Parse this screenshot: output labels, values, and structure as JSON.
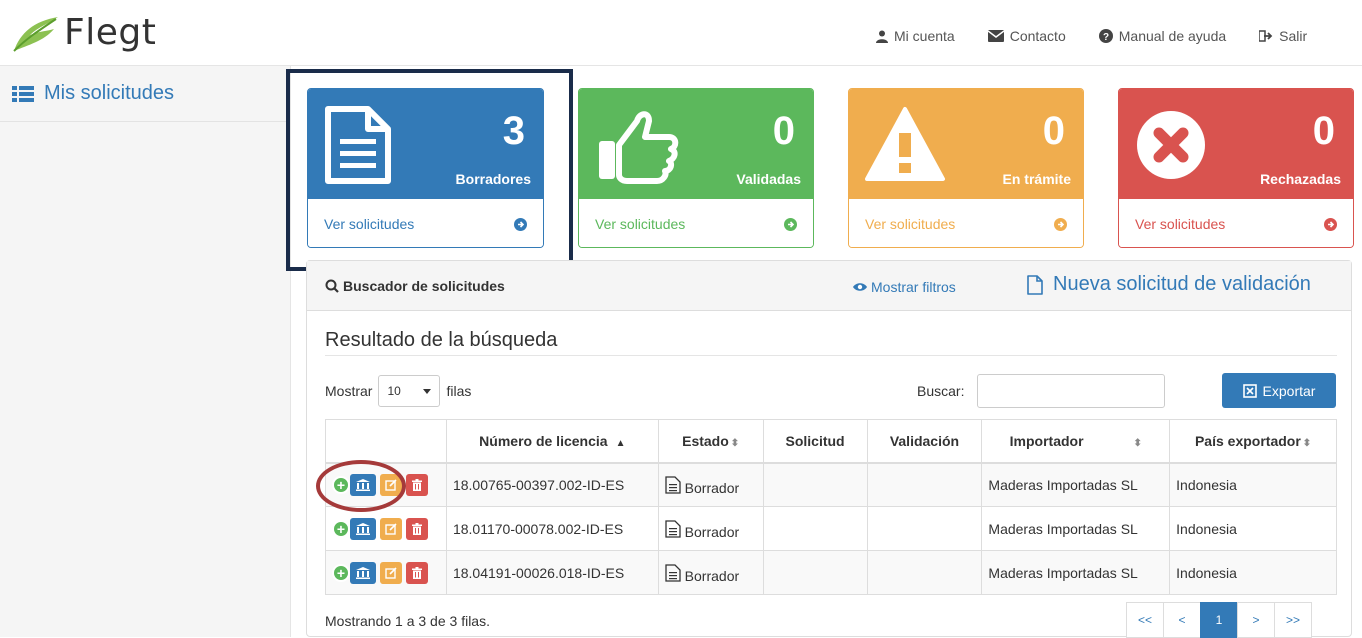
{
  "app": {
    "name": "Flegt"
  },
  "topnav": [
    {
      "label": "Mi cuenta",
      "icon": "user-icon"
    },
    {
      "label": "Contacto",
      "icon": "envelope-icon"
    },
    {
      "label": "Manual de ayuda",
      "icon": "question-circle-icon"
    },
    {
      "label": "Salir",
      "icon": "sign-out-icon"
    }
  ],
  "sidebar": {
    "items": [
      {
        "label": "Mis solicitudes",
        "icon": "list-icon"
      }
    ]
  },
  "cards": [
    {
      "count": "3",
      "label": "Borradores",
      "link": "Ver solicitudes",
      "color": "#337ab7",
      "icon": "document-icon"
    },
    {
      "count": "0",
      "label": "Validadas",
      "link": "Ver solicitudes",
      "color": "#5cb85c",
      "icon": "thumbs-up-icon"
    },
    {
      "count": "0",
      "label": "En trámite",
      "link": "Ver solicitudes",
      "color": "#f0ad4e",
      "icon": "warning-icon"
    },
    {
      "count": "0",
      "label": "Rechazadas",
      "link": "Ver solicitudes",
      "color": "#d9534f",
      "icon": "times-circle-icon"
    }
  ],
  "panel": {
    "title": "Buscador de solicitudes",
    "show_filters": "Mostrar filtros",
    "new_request": "Nueva solicitud de validación",
    "result_title": "Resultado de la búsqueda",
    "show_prefix": "Mostrar",
    "page_size": "10",
    "show_suffix": "filas",
    "search_label": "Buscar:",
    "search_value": "",
    "export_label": "Exportar"
  },
  "table": {
    "columns": [
      "",
      "Número de licencia",
      "Estado",
      "Solicitud",
      "Validación",
      "Importador",
      "País exportador"
    ],
    "rows": [
      {
        "licencia": "18.00765-00397.002-ID-ES",
        "estado": "Borrador",
        "solicitud": "",
        "validacion": "",
        "importador": "Maderas Importadas SL",
        "pais": "Indonesia"
      },
      {
        "licencia": "18.01170-00078.002-ID-ES",
        "estado": "Borrador",
        "solicitud": "",
        "validacion": "",
        "importador": "Maderas Importadas SL",
        "pais": "Indonesia"
      },
      {
        "licencia": "18.04191-00026.018-ID-ES",
        "estado": "Borrador",
        "solicitud": "",
        "validacion": "",
        "importador": "Maderas Importadas SL",
        "pais": "Indonesia"
      }
    ]
  },
  "footer": {
    "info": "Mostrando 1 a 3 de 3 filas.",
    "pager": [
      "<<",
      "<",
      "1",
      ">",
      ">>"
    ],
    "active_page": "1"
  }
}
